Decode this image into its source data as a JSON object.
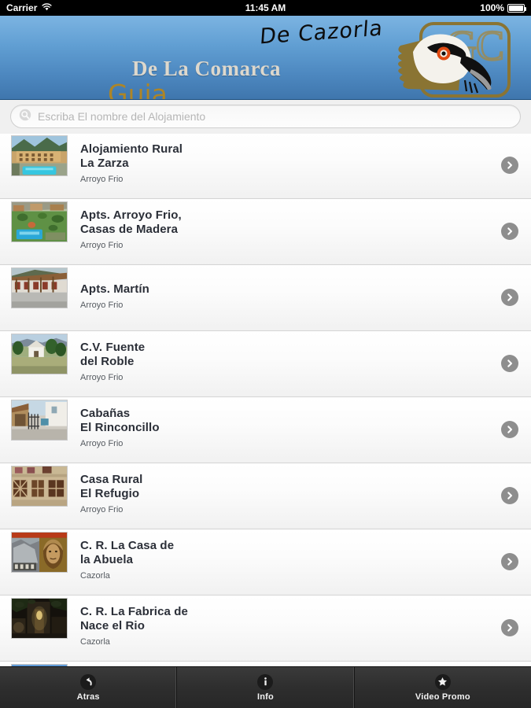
{
  "status_bar": {
    "carrier": "Carrier",
    "time": "11:45 AM",
    "battery": "100%",
    "wifi_icon": "wifi-icon",
    "battery_icon": "battery-icon"
  },
  "header": {
    "line_top": "De Cazorla",
    "line_mid": "De La Comarca",
    "line_bottom": "Guia",
    "logo_icon": "bearded-vulture-logo",
    "logo_monogram": "GC",
    "colors": {
      "gradient_top": "#7cb4e2",
      "gradient_bottom": "#3f76ad",
      "title_cream": "#ddd8cd",
      "guia_gold": "#ae8526",
      "logo_olive": "#8a7433"
    }
  },
  "search": {
    "placeholder": "Escriba El nombre del Alojamiento",
    "value": "",
    "icon": "search-icon"
  },
  "list": {
    "items": [
      {
        "title_lines": [
          "Alojamiento Rural",
          "La Zarza"
        ],
        "subtitle": "Arroyo Frio",
        "thumb": "hotel-pool-mountain"
      },
      {
        "title_lines": [
          "Apts. Arroyo Frio,",
          "Casas de Madera"
        ],
        "subtitle": "Arroyo Frio",
        "thumb": "garden-pool-aerial"
      },
      {
        "title_lines": [
          "Apts. Martín"
        ],
        "subtitle": "Arroyo Frio",
        "thumb": "street-building"
      },
      {
        "title_lines": [
          "C.V. Fuente",
          "del Roble"
        ],
        "subtitle": "Arroyo Frio",
        "thumb": "white-house-trees"
      },
      {
        "title_lines": [
          "Cabañas",
          "El Rinconcillo"
        ],
        "subtitle": "Arroyo Frio",
        "thumb": "village-gate"
      },
      {
        "title_lines": [
          "Casa Rural",
          "El Refugio"
        ],
        "subtitle": "Arroyo Frio",
        "thumb": "stone-facade-balcony"
      },
      {
        "title_lines": [
          "C. R. La Casa de",
          "la Abuela"
        ],
        "subtitle": "Cazorla",
        "thumb": "old-woman-portrait"
      },
      {
        "title_lines": [
          "C. R. La Fabrica de",
          "Nace el Rio"
        ],
        "subtitle": "Cazorla",
        "thumb": "night-alley-lantern"
      }
    ],
    "partial_item": {
      "thumb": "blue-sky-partial"
    }
  },
  "toolbar": {
    "buttons": [
      {
        "label": "Atras",
        "icon": "back-arrow-icon"
      },
      {
        "label": "Info",
        "icon": "info-icon"
      },
      {
        "label": "Video Promo",
        "icon": "star-icon"
      }
    ]
  }
}
